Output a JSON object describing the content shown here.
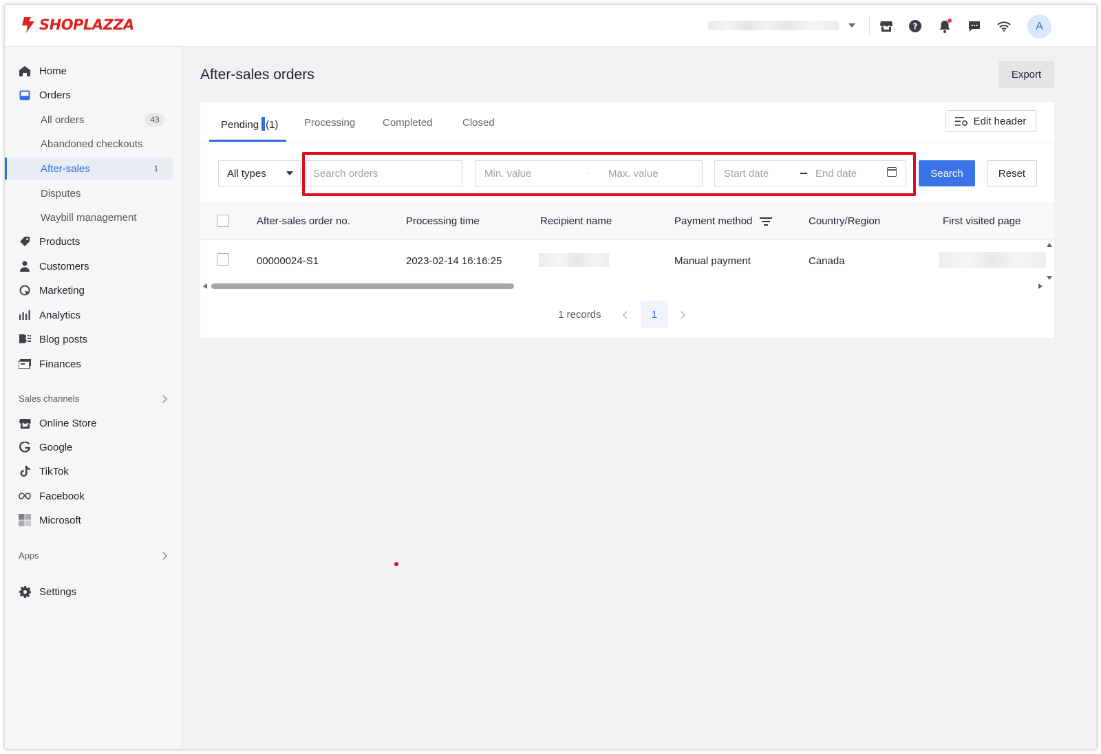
{
  "brand": {
    "name": "SHOPLAZZA",
    "color": "#e02020"
  },
  "topbar": {
    "icons": [
      "store-icon",
      "help-icon",
      "bell-icon",
      "chat-icon",
      "wifi-icon"
    ],
    "avatar_initial": "A"
  },
  "sidebar": {
    "items": [
      {
        "label": "Home",
        "icon": "home-icon"
      },
      {
        "label": "Orders",
        "icon": "orders-icon"
      },
      {
        "label": "Products",
        "icon": "tag-icon"
      },
      {
        "label": "Customers",
        "icon": "person-icon"
      },
      {
        "label": "Marketing",
        "icon": "marketing-icon"
      },
      {
        "label": "Analytics",
        "icon": "bar-chart-icon"
      },
      {
        "label": "Blog posts",
        "icon": "blog-icon"
      },
      {
        "label": "Finances",
        "icon": "finance-icon"
      }
    ],
    "order_subitems": [
      {
        "label": "All orders",
        "count": "43"
      },
      {
        "label": "Abandoned checkouts",
        "count": ""
      },
      {
        "label": "After-sales",
        "count": "1"
      },
      {
        "label": "Disputes",
        "count": ""
      },
      {
        "label": "Waybill management",
        "count": ""
      }
    ],
    "sales_channels_label": "Sales channels",
    "channels": [
      {
        "label": "Online Store",
        "icon": "store-icon"
      },
      {
        "label": "Google",
        "icon": "google-icon"
      },
      {
        "label": "TikTok",
        "icon": "tiktok-icon"
      },
      {
        "label": "Facebook",
        "icon": "meta-icon"
      },
      {
        "label": "Microsoft",
        "icon": "microsoft-icon"
      }
    ],
    "apps_label": "Apps",
    "settings_label": "Settings"
  },
  "main": {
    "title": "After-sales orders",
    "export_label": "Export",
    "tabs": [
      {
        "label": "Pending",
        "count": "(1)"
      },
      {
        "label": "Processing"
      },
      {
        "label": "Completed"
      },
      {
        "label": "Closed"
      }
    ],
    "edit_header_label": "Edit header",
    "filters": {
      "type_value": "All types",
      "search_placeholder": "Search orders",
      "min_placeholder": "Min. value",
      "range_separator": "-",
      "max_placeholder": "Max. value",
      "start_date_placeholder": "Start date",
      "end_date_placeholder": "End date",
      "search_label": "Search",
      "reset_label": "Reset"
    },
    "table": {
      "columns": [
        "After-sales order no.",
        "Processing time",
        "Recipient name",
        "Payment method",
        "Country/Region",
        "First visited page"
      ],
      "rows": [
        {
          "order_no": "00000024-S1",
          "processing_time": "2023-02-14 16:16:25",
          "recipient": "",
          "payment": "Manual payment",
          "country": "Canada",
          "first_page": ""
        }
      ]
    },
    "pagination": {
      "records": "1 records",
      "current_page": "1"
    }
  },
  "colors": {
    "accent": "#3b74e8",
    "highlight": "#d9101c"
  }
}
